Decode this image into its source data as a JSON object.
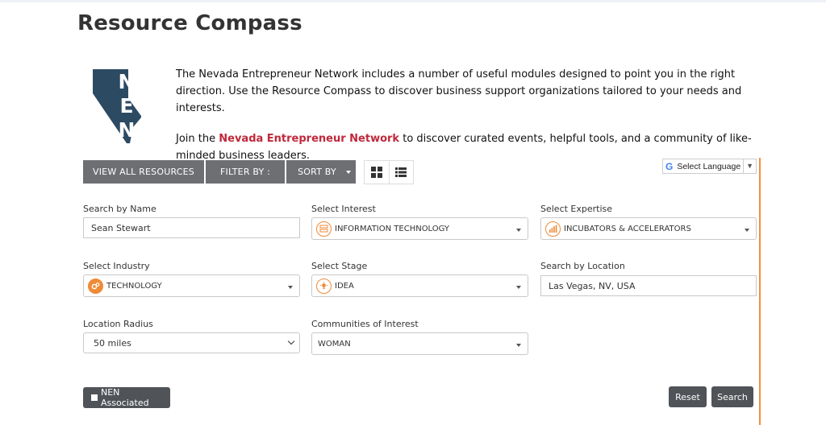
{
  "page": {
    "title": "Resource Compass"
  },
  "logo": {
    "letters": [
      "N",
      "E",
      "N"
    ]
  },
  "intro": {
    "paragraph1": "The Nevada Entrepreneur Network includes a number of useful modules designed to point you in the right direction. Use the Resource Compass to discover business support organizations tailored to your needs and interests.",
    "paragraph2_before": "Join the ",
    "paragraph2_link": "Nevada Entrepreneur Network",
    "paragraph2_after": " to discover curated events, helpful tools, and a community of like-minded business leaders."
  },
  "toolbar": {
    "view_all": "VIEW ALL RESOURCES",
    "filter_by": "FILTER BY :",
    "sort_by": "SORT BY",
    "grid_view_icon": "grid-icon",
    "list_view_icon": "list-icon"
  },
  "language": {
    "label": "Select Language",
    "dropdown": "▼"
  },
  "form": {
    "search_name": {
      "label": "Search by Name",
      "value": "Sean Stewart"
    },
    "interest": {
      "label": "Select Interest",
      "value": "INFORMATION TECHNOLOGY",
      "icon": "server-icon"
    },
    "expertise": {
      "label": "Select Expertise",
      "value": "INCUBATORS & ACCELERATORS",
      "icon": "bar-chart-icon"
    },
    "industry": {
      "label": "Select Industry",
      "value": "TECHNOLOGY",
      "icon": "gears-icon"
    },
    "stage": {
      "label": "Select Stage",
      "value": "IDEA",
      "icon": "lightbulb-icon"
    },
    "location": {
      "label": "Search by Location",
      "value": "Las Vegas, NV, USA"
    },
    "radius": {
      "label": "Location Radius",
      "value": "50 miles"
    },
    "communities": {
      "label": "Communities of Interest",
      "value": "WOMAN"
    }
  },
  "actions": {
    "nen_associated": "NEN Associated",
    "reset": "Reset",
    "search": "Search"
  },
  "colors": {
    "accent": "#ef8a37",
    "link": "#c0283a",
    "button": "#6d6f73",
    "dark_button": "#505357",
    "logo": "#2d4a63"
  }
}
